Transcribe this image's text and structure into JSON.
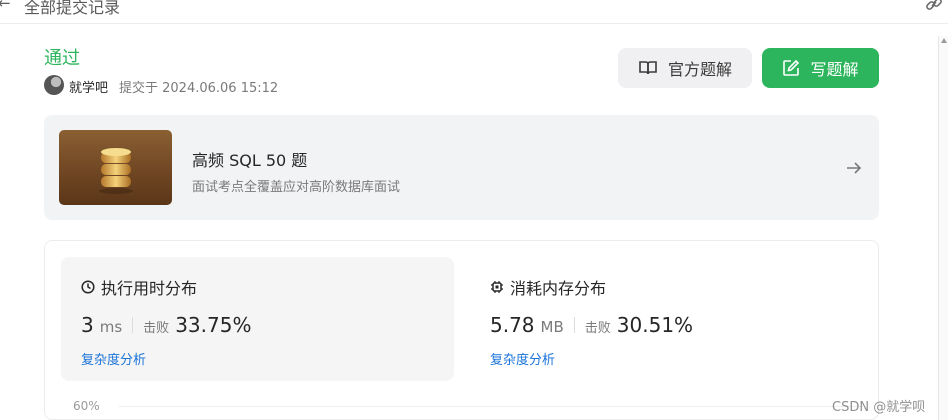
{
  "header": {
    "back_icon": "arrow-left-icon",
    "title": "全部提交记录",
    "link_icon": "link-icon"
  },
  "submission": {
    "status": "通过",
    "status_color": "#2db55d",
    "author": "就学吧",
    "submitted_at": "提交于 2024.06.06 15:12"
  },
  "actions": {
    "official_solution": {
      "label": "官方题解",
      "icon": "book-open-icon"
    },
    "write_solution": {
      "label": "写题解",
      "icon": "edit-icon",
      "color": "#2db55d"
    }
  },
  "study_plan": {
    "title": "高频 SQL 50 题",
    "subtitle": "面试考点全覆盖应对高阶数据库面试",
    "thumb_icon": "database-coins-icon",
    "arrow_icon": "arrow-right-icon"
  },
  "runtime": {
    "title": "执行用时分布",
    "icon": "clock-icon",
    "value": "3",
    "unit": "ms",
    "beat_label": "击败",
    "beat_value": "33.75%",
    "analysis_link": "复杂度分析"
  },
  "memory": {
    "title": "消耗内存分布",
    "icon": "chip-icon",
    "value": "5.78",
    "unit": "MB",
    "beat_label": "击败",
    "beat_value": "30.51%",
    "analysis_link": "复杂度分析"
  },
  "chart": {
    "y_tick": "60%"
  },
  "watermark": "CSDN @就学呗"
}
